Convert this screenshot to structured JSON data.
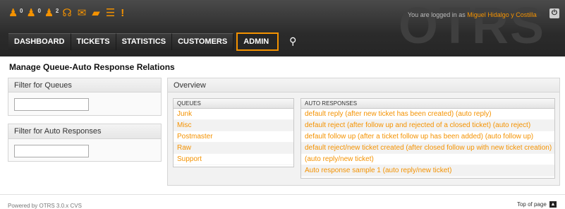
{
  "header": {
    "watermark": "OTRS",
    "login_prefix": "You are logged in as ",
    "user_name": "Miguel Hidalgo y Costilla",
    "logout_icon": "power-icon",
    "toolbar": [
      {
        "icon": "locked-tickets-icon",
        "glyph": "♟",
        "count": "0"
      },
      {
        "icon": "watched-tickets-icon",
        "glyph": "♟",
        "count": "0"
      },
      {
        "icon": "responsible-tickets-icon",
        "glyph": "♟",
        "count": "2"
      },
      {
        "icon": "headset-icon",
        "glyph": "☊"
      },
      {
        "icon": "mail-icon",
        "glyph": "✉"
      },
      {
        "icon": "folder-icon",
        "glyph": "▰"
      },
      {
        "icon": "list-icon",
        "glyph": "☰"
      },
      {
        "icon": "alert-icon",
        "glyph": "!"
      }
    ],
    "nav": {
      "dashboard": "DASHBOARD",
      "tickets": "TICKETS",
      "statistics": "STATISTICS",
      "customers": "CUSTOMERS",
      "admin": "ADMIN",
      "search_glyph": "⚲"
    }
  },
  "page": {
    "title": "Manage Queue-Auto Response Relations"
  },
  "sidebar": {
    "filter_queues": {
      "title": "Filter for Queues",
      "value": ""
    },
    "filter_responses": {
      "title": "Filter for Auto Responses",
      "value": ""
    }
  },
  "overview": {
    "title": "Overview",
    "queues_header": "QUEUES",
    "queues": [
      "Junk",
      "Misc",
      "Postmaster",
      "Raw",
      "Support"
    ],
    "responses_header": "AUTO RESPONSES",
    "responses": [
      "default reply (after new ticket has been created) (auto reply)",
      "default reject (after follow up and rejected of a closed ticket) (auto reject)",
      "default follow up (after a ticket follow up has been added) (auto follow up)",
      "default reject/new ticket created (after closed follow up with new ticket creation)",
      "(auto reply/new ticket)",
      "Auto response sample 1 (auto reply/new ticket)"
    ]
  },
  "footer": {
    "powered_by": "Powered by OTRS 3.0.x CVS",
    "top_of_page": "Top of page",
    "top_icon_glyph": "▲"
  },
  "colors": {
    "accent": "#f49200",
    "header_bg": "#2b2b2b"
  }
}
